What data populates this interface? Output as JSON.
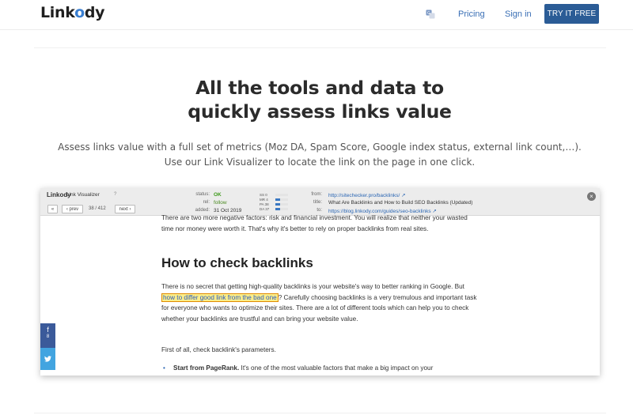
{
  "header": {
    "logo": {
      "before": "Link",
      "accent": "o",
      "after": "dy"
    },
    "nav": {
      "pricing": "Pricing",
      "signin": "Sign in",
      "cta": "TRY IT FREE"
    },
    "icons": {
      "translate": "translate-icon"
    }
  },
  "hero": {
    "title_line1": "All the tools and data to",
    "title_line2": "quickly assess links value",
    "subtitle_line1": "Assess links value with a full set of metrics (Moz DA, Spam Score, Google index status, external link count,…).",
    "subtitle_line2": "Use our Link Visualizer to locate the link on the page in one click."
  },
  "link_visualizer": {
    "logo": "Linkody",
    "title": "Link Visualizer",
    "help": "?",
    "nav": {
      "first": "«",
      "prev": "‹ prev",
      "count": "38 / 412",
      "next": "next ›"
    },
    "status_label": "status:",
    "status_value": "OK",
    "rel_label": "rel:",
    "rel_value": "follow",
    "added_label": "added:",
    "added_value": "31 Oct 2019",
    "metrics": [
      {
        "label": "SS",
        "value": "0",
        "fill": 0.0
      },
      {
        "label": "MR",
        "value": "4",
        "fill": 0.4
      },
      {
        "label": "PA",
        "value": "38",
        "fill": 0.38
      },
      {
        "label": "DA",
        "value": "37",
        "fill": 0.37
      }
    ],
    "from_label": "from:",
    "from_value": "http://sitechecker.pro/backlinks/",
    "title_label": "title:",
    "title_value": "What Are Backlinks and How to Build SEO Backlinks (Updated)",
    "to_label": "to:",
    "to_value": "https://blog.linkody.com/guides/seo-backlinks",
    "close": "×"
  },
  "article": {
    "p1": "There are two more negative factors: risk and financial investment. You will realize that neither your wasted time nor money were worth it. That's why it's better to rely on proper backlinks from real sites.",
    "heading": "How to check backlinks",
    "p2_before": "There is no secret that getting high-quality backlinks is your website's way to better ranking in Google. But ",
    "p2_highlight": "how to differ good link from the bad one",
    "p2_after": "? Carefully choosing backlinks is a very tremulous and important task for everyone who wants to optimize their sites. There are a lot of different tools which can help you to check whether your backlinks are trustful and can bring your website value.",
    "p3": "First of all, check backlink's parameters.",
    "li_bold": "Start from PageRank.",
    "li_rest": " It's one of the most valuable factors that make a big impact on your"
  },
  "share": {
    "facebook_icon": "f",
    "facebook_count": "8",
    "twitter_icon": "twitter-icon"
  }
}
